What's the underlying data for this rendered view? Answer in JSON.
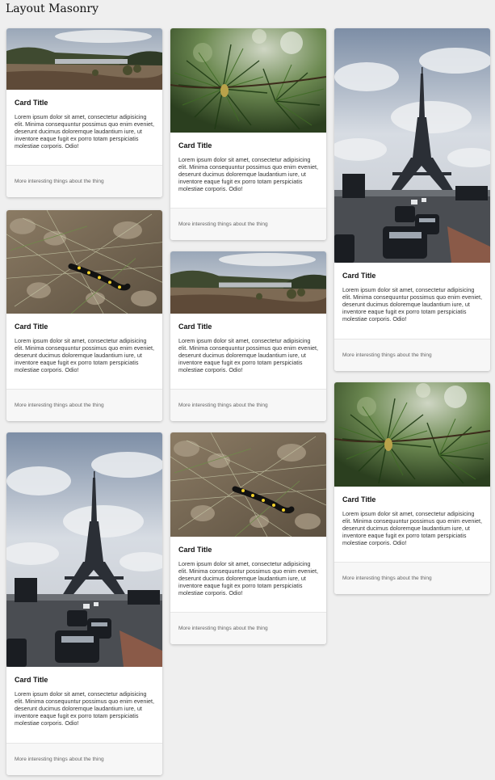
{
  "page": {
    "title": "Layout Masonry"
  },
  "cards": [
    {
      "title": "Card Title",
      "text": "Lorem ipsum dolor sit amet, consectetur adipisicing elit. Minima consequuntur possimus quo enim eveniet, deserunt ducimus doloremque laudantium iure, ut inventore eaque fugit ex porro totam perspiciatis molestiae corporis. Odio!",
      "footer": "More interesting things about the thing",
      "image": "landscape"
    },
    {
      "title": "Card Title",
      "text": "Lorem ipsum dolor sit amet, consectetur adipisicing elit. Minima consequuntur possimus quo enim eveniet, deserunt ducimus doloremque laudantium iure, ut inventore eaque fugit ex porro totam perspiciatis molestiae corporis. Odio!",
      "footer": "More interesting things about the thing",
      "image": "pine"
    },
    {
      "title": "Card Title",
      "text": "Lorem ipsum dolor sit amet, consectetur adipisicing elit. Minima consequuntur possimus quo enim eveniet, deserunt ducimus doloremque laudantium iure, ut inventore eaque fugit ex porro totam perspiciatis molestiae corporis. Odio!",
      "footer": "More interesting things about the thing",
      "image": "eiffel"
    },
    {
      "title": "Card Title",
      "text": "Lorem ipsum dolor sit amet, consectetur adipisicing elit. Minima consequuntur possimus quo enim eveniet, deserunt ducimus doloremque laudantium iure, ut inventore eaque fugit ex porro totam perspiciatis molestiae corporis. Odio!",
      "footer": "More interesting things about the thing",
      "image": "salamander"
    },
    {
      "title": "Card Title",
      "text": "Lorem ipsum dolor sit amet, consectetur adipisicing elit. Minima consequuntur possimus quo enim eveniet, deserunt ducimus doloremque laudantium iure, ut inventore eaque fugit ex porro totam perspiciatis molestiae corporis. Odio!",
      "footer": "More interesting things about the thing",
      "image": "landscape"
    },
    {
      "title": "Card Title",
      "text": "Lorem ipsum dolor sit amet, consectetur adipisicing elit. Minima consequuntur possimus quo enim eveniet, deserunt ducimus doloremque laudantium iure, ut inventore eaque fugit ex porro totam perspiciatis molestiae corporis. Odio!",
      "footer": "More interesting things about the thing",
      "image": "pine"
    },
    {
      "title": "Card Title",
      "text": "Lorem ipsum dolor sit amet, consectetur adipisicing elit. Minima consequuntur possimus quo enim eveniet, deserunt ducimus doloremque laudantium iure, ut inventore eaque fugit ex porro totam perspiciatis molestiae corporis. Odio!",
      "footer": "More interesting things about the thing",
      "image": "eiffel"
    },
    {
      "title": "Card Title",
      "text": "Lorem ipsum dolor sit amet, consectetur adipisicing elit. Minima consequuntur possimus quo enim eveniet, deserunt ducimus doloremque laudantium iure, ut inventore eaque fugit ex porro totam perspiciatis molestiae corporis. Odio!",
      "footer": "More interesting things about the thing",
      "image": "salamander"
    }
  ]
}
